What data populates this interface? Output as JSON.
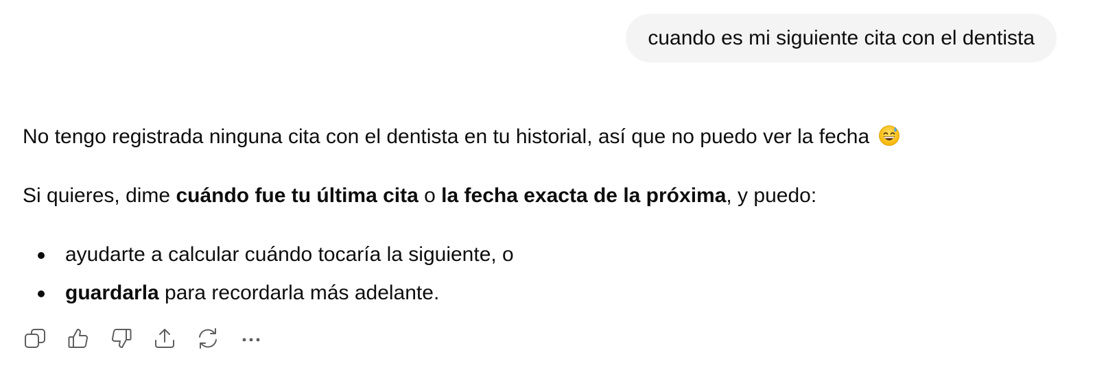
{
  "user_message": {
    "text": "cuando es mi siguiente cita con el dentista"
  },
  "assistant_message": {
    "paragraph1": {
      "text": "No tengo registrada ninguna cita con el dentista en tu historial, así que no puedo ver la fecha",
      "emoji": "grinning-face-with-sweat"
    },
    "paragraph2": {
      "t1": "Si quieres, dime ",
      "b1": "cuándo fue tu última cita",
      "t2": " o ",
      "b2": "la fecha exacta de la próxima",
      "t3": ", y puedo:"
    },
    "bullets": [
      {
        "bold": "",
        "text": "ayudarte a calcular cuándo tocaría la siguiente, o"
      },
      {
        "bold": "guardarla",
        "text": " para recordarla más adelante."
      }
    ]
  },
  "action_bar": {
    "icons": [
      "copy-icon",
      "thumbs-up-icon",
      "thumbs-down-icon",
      "share-icon",
      "regenerate-icon",
      "more-icon"
    ]
  },
  "colors": {
    "bubble_bg": "#f4f4f4",
    "text": "#0d0d0d",
    "icon": "#5d5d5d"
  }
}
